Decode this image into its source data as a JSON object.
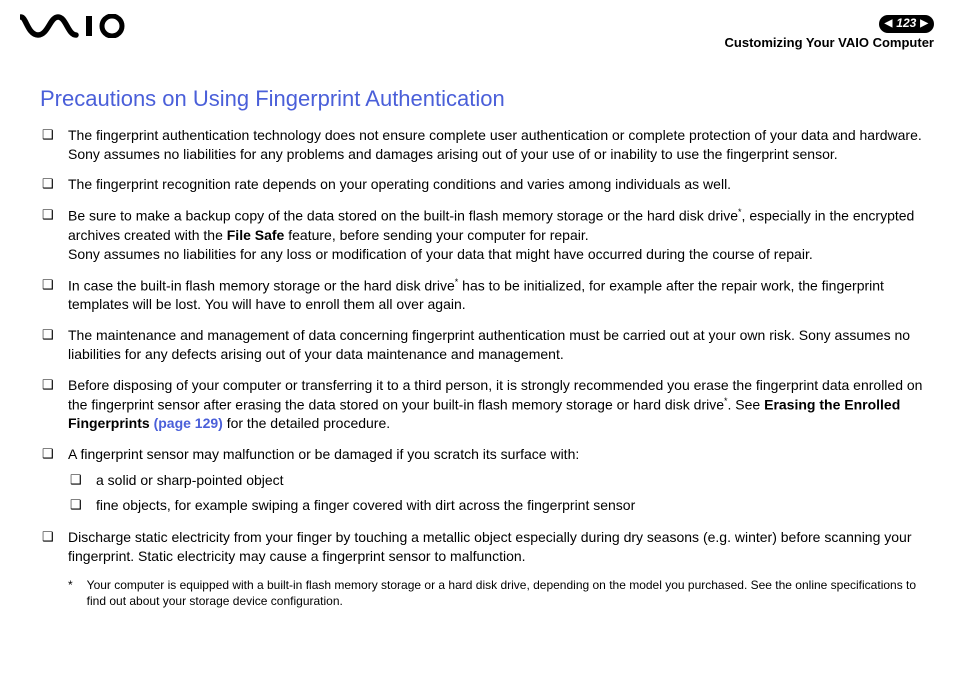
{
  "header": {
    "page_number": "123",
    "breadcrumb": "Customizing Your VAIO Computer"
  },
  "title": "Precautions on Using Fingerprint Authentication",
  "bullets": [
    {
      "text1": "The fingerprint authentication technology does not ensure complete user authentication or complete protection of your data and hardware.",
      "text2": "Sony assumes no liabilities for any problems and damages arising out of your use of or inability to use the fingerprint sensor."
    },
    {
      "text1": "The fingerprint recognition rate depends on your operating conditions and varies among individuals as well."
    },
    {
      "pre": "Be sure to make a backup copy of the data stored on the built-in flash memory storage or the hard disk drive",
      "mid": ", especially in the encrypted archives created with the ",
      "bold": "File Safe",
      "post": " feature, before sending your computer for repair.",
      "text2": "Sony assumes no liabilities for any loss or modification of your data that might have occurred during the course of repair."
    },
    {
      "pre": "In case the built-in flash memory storage or the hard disk drive",
      "post": " has to be initialized, for example after the repair work, the fingerprint templates will be lost. You will have to enroll them all over again."
    },
    {
      "text1": "The maintenance and management of data concerning fingerprint authentication must be carried out at your own risk. Sony assumes no liabilities for any defects arising out of your data maintenance and management."
    },
    {
      "pre": "Before disposing of your computer or transferring it to a third person, it is strongly recommended you erase the fingerprint data enrolled on the fingerprint sensor after erasing the data stored on your built-in flash memory storage or hard disk drive",
      "mid": ". See ",
      "bold": "Erasing the Enrolled Fingerprints ",
      "link": "(page 129)",
      "post": " for the detailed procedure."
    },
    {
      "text1": "A fingerprint sensor may malfunction or be damaged if you scratch its surface with:",
      "sub": [
        "a solid or sharp-pointed object",
        "fine objects, for example swiping a finger covered with dirt across the fingerprint sensor"
      ]
    },
    {
      "text1": "Discharge static electricity from your finger by touching a metallic object especially during dry seasons (e.g. winter) before scanning your fingerprint. Static electricity may cause a fingerprint sensor to malfunction."
    }
  ],
  "footnote": {
    "marker": "*",
    "text": "Your computer is equipped with a built-in flash memory storage or a hard disk drive, depending on the model you purchased. See the online specifications to find out about your storage device configuration."
  }
}
